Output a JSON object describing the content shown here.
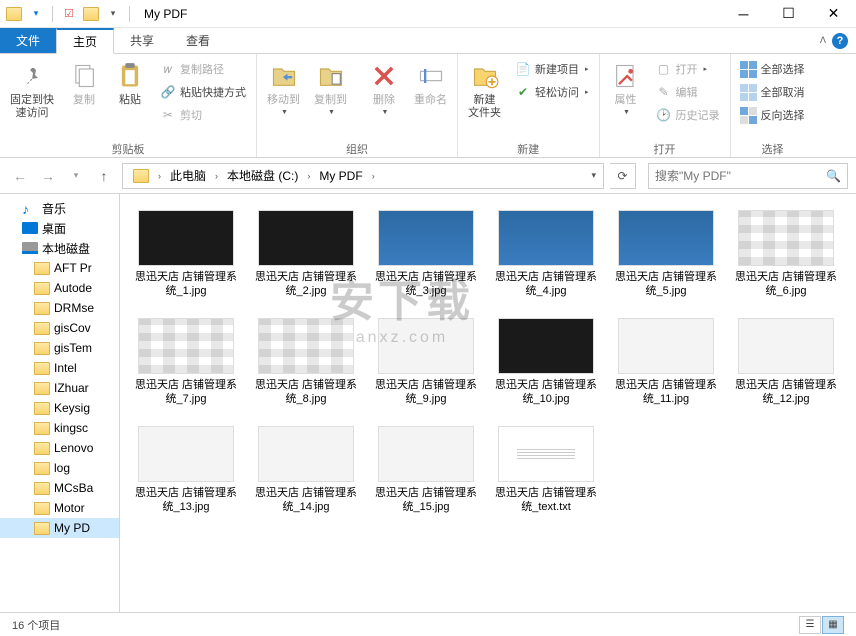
{
  "window": {
    "title": "My PDF",
    "minimize": "─",
    "maximize": "☐",
    "close": "✕"
  },
  "tabs": {
    "file": "文件",
    "home": "主页",
    "share": "共享",
    "view": "查看"
  },
  "ribbon": {
    "clipboard": {
      "pin": "固定到快\n速访问",
      "copy": "复制",
      "paste": "粘贴",
      "copyPath": "复制路径",
      "pasteShortcut": "粘贴快捷方式",
      "cut": "剪切",
      "label": "剪贴板"
    },
    "organize": {
      "moveTo": "移动到",
      "copyTo": "复制到",
      "delete": "删除",
      "rename": "重命名",
      "label": "组织"
    },
    "new_": {
      "newFolder": "新建\n文件夹",
      "newItem": "新建项目",
      "easyAccess": "轻松访问",
      "label": "新建"
    },
    "open": {
      "properties": "属性",
      "open": "打开",
      "edit": "编辑",
      "history": "历史记录",
      "label": "打开"
    },
    "select": {
      "selectAll": "全部选择",
      "selectNone": "全部取消",
      "invert": "反向选择",
      "label": "选择"
    }
  },
  "nav": {
    "crumbs": [
      "此电脑",
      "本地磁盘 (C:)",
      "My PDF"
    ],
    "searchPlaceholder": "搜索\"My PDF\""
  },
  "sidebar": [
    {
      "icon": "music",
      "label": "音乐",
      "lvl": 1
    },
    {
      "icon": "desktop",
      "label": "桌面",
      "lvl": 1
    },
    {
      "icon": "disk",
      "label": "本地磁盘",
      "lvl": 1
    },
    {
      "icon": "folder",
      "label": "AFT Pr",
      "lvl": 2
    },
    {
      "icon": "folder",
      "label": "Autode",
      "lvl": 2
    },
    {
      "icon": "folder",
      "label": "DRMse",
      "lvl": 2
    },
    {
      "icon": "folder",
      "label": "gisCov",
      "lvl": 2
    },
    {
      "icon": "folder",
      "label": "gisTem",
      "lvl": 2
    },
    {
      "icon": "folder",
      "label": "Intel",
      "lvl": 2
    },
    {
      "icon": "folder",
      "label": "IZhuar",
      "lvl": 2
    },
    {
      "icon": "folder",
      "label": "Keysig",
      "lvl": 2
    },
    {
      "icon": "folder",
      "label": "kingsc",
      "lvl": 2
    },
    {
      "icon": "folder",
      "label": "Lenovo",
      "lvl": 2
    },
    {
      "icon": "folder",
      "label": "log",
      "lvl": 2
    },
    {
      "icon": "folder",
      "label": "MCsBa",
      "lvl": 2
    },
    {
      "icon": "folder",
      "label": "Motor",
      "lvl": 2
    },
    {
      "icon": "folder",
      "label": "My PD",
      "lvl": 2,
      "selected": true
    }
  ],
  "files": [
    {
      "name": "思迅天店 店铺管理系统_1.jpg",
      "thumb": "dark"
    },
    {
      "name": "思迅天店 店铺管理系统_2.jpg",
      "thumb": "dark"
    },
    {
      "name": "思迅天店 店铺管理系统_3.jpg",
      "thumb": "blue"
    },
    {
      "name": "思迅天店 店铺管理系统_4.jpg",
      "thumb": "blue"
    },
    {
      "name": "思迅天店 店铺管理系统_5.jpg",
      "thumb": "blue"
    },
    {
      "name": "思迅天店 店铺管理系统_6.jpg",
      "thumb": "grid"
    },
    {
      "name": "思迅天店 店铺管理系统_7.jpg",
      "thumb": "grid"
    },
    {
      "name": "思迅天店 店铺管理系统_8.jpg",
      "thumb": "grid"
    },
    {
      "name": "思迅天店 店铺管理系统_9.jpg",
      "thumb": "light"
    },
    {
      "name": "思迅天店 店铺管理系统_10.jpg",
      "thumb": "dark"
    },
    {
      "name": "思迅天店 店铺管理系统_11.jpg",
      "thumb": "light"
    },
    {
      "name": "思迅天店 店铺管理系统_12.jpg",
      "thumb": "light"
    },
    {
      "name": "思迅天店 店铺管理系统_13.jpg",
      "thumb": "light"
    },
    {
      "name": "思迅天店 店铺管理系统_14.jpg",
      "thumb": "light"
    },
    {
      "name": "思迅天店 店铺管理系统_15.jpg",
      "thumb": "light"
    },
    {
      "name": "思迅天店 店铺管理系统_text.txt",
      "thumb": "txt"
    }
  ],
  "status": {
    "count": "16 个项目"
  },
  "watermark": {
    "l1": "安下载",
    "l2": "anxz.com"
  }
}
